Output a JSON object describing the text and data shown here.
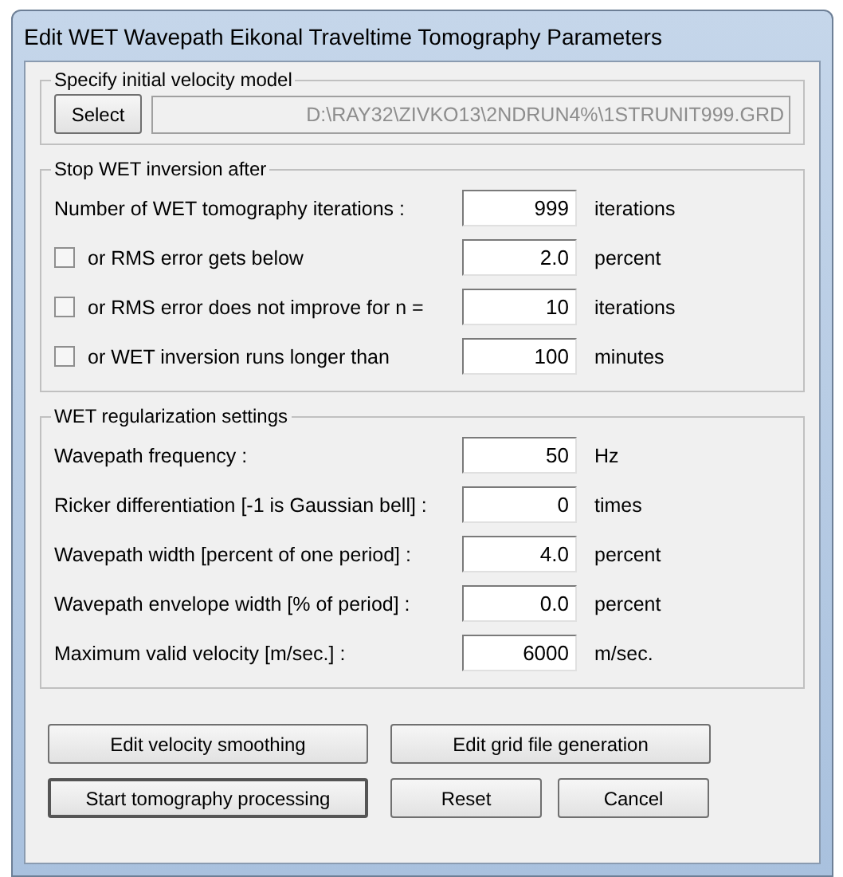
{
  "window": {
    "title": "Edit WET Wavepath Eikonal Traveltime Tomography Parameters"
  },
  "initial_model": {
    "legend": "Specify initial velocity model",
    "button": "Select",
    "path": "D:\\RAY32\\ZIVKO13\\2NDRUN4%\\1STRUNIT999.GRD"
  },
  "stop_group": {
    "legend": "Stop WET inversion after",
    "rows": [
      {
        "kind": "plain",
        "label": "Number of WET tomography iterations :",
        "value": "999",
        "unit": "iterations"
      },
      {
        "kind": "checkbox",
        "checked": false,
        "label": "or RMS error gets below",
        "value": "2.0",
        "unit": "percent"
      },
      {
        "kind": "checkbox",
        "checked": false,
        "label": "or RMS error does not improve for n =",
        "value": "10",
        "unit": "iterations"
      },
      {
        "kind": "checkbox",
        "checked": false,
        "label": "or WET inversion runs longer than",
        "value": "100",
        "unit": "minutes"
      }
    ]
  },
  "regularization": {
    "legend": "WET regularization settings",
    "rows": [
      {
        "label": "Wavepath frequency :",
        "value": "50",
        "unit": "Hz"
      },
      {
        "label": "Ricker differentiation [-1 is Gaussian bell] :",
        "value": "0",
        "unit": "times"
      },
      {
        "label": "Wavepath width [percent of one period] :",
        "value": "4.0",
        "unit": "percent"
      },
      {
        "label": "Wavepath envelope width [% of period] :",
        "value": "0.0",
        "unit": "percent"
      },
      {
        "label": "Maximum valid velocity [m/sec.] :",
        "value": "6000",
        "unit": "m/sec."
      }
    ]
  },
  "buttons_top": [
    "Edit velocity smoothing",
    "Edit grid file generation"
  ],
  "buttons_bottom": [
    "Start tomography processing",
    "Reset",
    "Cancel"
  ]
}
